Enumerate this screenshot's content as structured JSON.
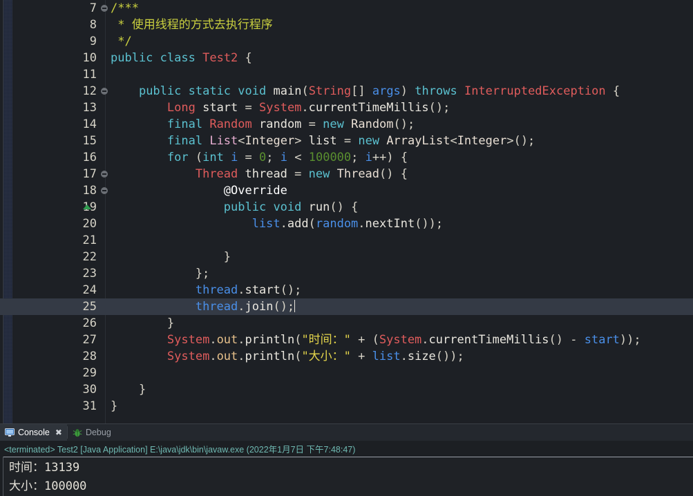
{
  "editor": {
    "first_line": 7,
    "lines": [
      {
        "no": 7,
        "fold": true,
        "override": false,
        "current": false,
        "tokens": [
          {
            "t": "/***",
            "c": "cmt"
          }
        ]
      },
      {
        "no": 8,
        "fold": false,
        "override": false,
        "current": false,
        "tokens": [
          {
            "t": " * 使用线程的方式去执行程序",
            "c": "cmt"
          }
        ]
      },
      {
        "no": 9,
        "fold": false,
        "override": false,
        "current": false,
        "tokens": [
          {
            "t": " */",
            "c": "cmt"
          }
        ]
      },
      {
        "no": 10,
        "fold": false,
        "override": false,
        "current": false,
        "tokens": [
          {
            "t": "public",
            "c": "kw"
          },
          {
            "t": " ",
            "c": "pln"
          },
          {
            "t": "class",
            "c": "kw"
          },
          {
            "t": " ",
            "c": "pln"
          },
          {
            "t": "Test2",
            "c": "typ"
          },
          {
            "t": " {",
            "c": "pct"
          }
        ]
      },
      {
        "no": 11,
        "fold": false,
        "override": false,
        "current": false,
        "tokens": []
      },
      {
        "no": 12,
        "fold": true,
        "override": false,
        "current": false,
        "tokens": [
          {
            "t": "    ",
            "c": "pln"
          },
          {
            "t": "public",
            "c": "kw"
          },
          {
            "t": " ",
            "c": "pln"
          },
          {
            "t": "static",
            "c": "kw"
          },
          {
            "t": " ",
            "c": "pln"
          },
          {
            "t": "void",
            "c": "kw"
          },
          {
            "t": " ",
            "c": "pln"
          },
          {
            "t": "main",
            "c": "pln"
          },
          {
            "t": "(",
            "c": "pct"
          },
          {
            "t": "String",
            "c": "typ"
          },
          {
            "t": "[] ",
            "c": "pct"
          },
          {
            "t": "args",
            "c": "var"
          },
          {
            "t": ") ",
            "c": "pct"
          },
          {
            "t": "throws",
            "c": "kw"
          },
          {
            "t": " ",
            "c": "pln"
          },
          {
            "t": "InterruptedException",
            "c": "typ"
          },
          {
            "t": " {",
            "c": "pct"
          }
        ]
      },
      {
        "no": 13,
        "fold": false,
        "override": false,
        "current": false,
        "tokens": [
          {
            "t": "        ",
            "c": "pln"
          },
          {
            "t": "Long",
            "c": "typ"
          },
          {
            "t": " ",
            "c": "pln"
          },
          {
            "t": "start",
            "c": "pln"
          },
          {
            "t": " = ",
            "c": "pct"
          },
          {
            "t": "System",
            "c": "typ"
          },
          {
            "t": ".",
            "c": "pct"
          },
          {
            "t": "currentTimeMillis",
            "c": "pln"
          },
          {
            "t": "();",
            "c": "pct"
          }
        ]
      },
      {
        "no": 14,
        "fold": false,
        "override": false,
        "current": false,
        "tokens": [
          {
            "t": "        ",
            "c": "pln"
          },
          {
            "t": "final",
            "c": "kw"
          },
          {
            "t": " ",
            "c": "pln"
          },
          {
            "t": "Random",
            "c": "typ"
          },
          {
            "t": " ",
            "c": "pln"
          },
          {
            "t": "random",
            "c": "pln"
          },
          {
            "t": " = ",
            "c": "pct"
          },
          {
            "t": "new",
            "c": "kw"
          },
          {
            "t": " ",
            "c": "pln"
          },
          {
            "t": "Random",
            "c": "cls"
          },
          {
            "t": "();",
            "c": "pct"
          }
        ]
      },
      {
        "no": 15,
        "fold": false,
        "override": false,
        "current": false,
        "tokens": [
          {
            "t": "        ",
            "c": "pln"
          },
          {
            "t": "final",
            "c": "kw"
          },
          {
            "t": " ",
            "c": "pln"
          },
          {
            "t": "List",
            "c": "gen"
          },
          {
            "t": "<",
            "c": "pct"
          },
          {
            "t": "Integer",
            "c": "cls"
          },
          {
            "t": "> ",
            "c": "pct"
          },
          {
            "t": "list",
            "c": "pln"
          },
          {
            "t": " = ",
            "c": "pct"
          },
          {
            "t": "new",
            "c": "kw"
          },
          {
            "t": " ",
            "c": "pln"
          },
          {
            "t": "ArrayList",
            "c": "cls"
          },
          {
            "t": "<",
            "c": "pct"
          },
          {
            "t": "Integer",
            "c": "cls"
          },
          {
            "t": ">();",
            "c": "pct"
          }
        ]
      },
      {
        "no": 16,
        "fold": false,
        "override": false,
        "current": false,
        "tokens": [
          {
            "t": "        ",
            "c": "pln"
          },
          {
            "t": "for",
            "c": "kw"
          },
          {
            "t": " (",
            "c": "pct"
          },
          {
            "t": "int",
            "c": "kw"
          },
          {
            "t": " ",
            "c": "pln"
          },
          {
            "t": "i",
            "c": "var"
          },
          {
            "t": " = ",
            "c": "pct"
          },
          {
            "t": "0",
            "c": "num"
          },
          {
            "t": "; ",
            "c": "pct"
          },
          {
            "t": "i",
            "c": "var"
          },
          {
            "t": " < ",
            "c": "pct"
          },
          {
            "t": "100000",
            "c": "num"
          },
          {
            "t": "; ",
            "c": "pct"
          },
          {
            "t": "i",
            "c": "var"
          },
          {
            "t": "++) {",
            "c": "pct"
          }
        ]
      },
      {
        "no": 17,
        "fold": true,
        "override": false,
        "current": false,
        "tokens": [
          {
            "t": "            ",
            "c": "pln"
          },
          {
            "t": "Thread",
            "c": "typ"
          },
          {
            "t": " ",
            "c": "pln"
          },
          {
            "t": "thread",
            "c": "pln"
          },
          {
            "t": " = ",
            "c": "pct"
          },
          {
            "t": "new",
            "c": "kw"
          },
          {
            "t": " ",
            "c": "pln"
          },
          {
            "t": "Thread",
            "c": "cls"
          },
          {
            "t": "() {",
            "c": "pct"
          }
        ]
      },
      {
        "no": 18,
        "fold": true,
        "override": false,
        "current": false,
        "tokens": [
          {
            "t": "                ",
            "c": "pln"
          },
          {
            "t": "@Override",
            "c": "ann"
          }
        ]
      },
      {
        "no": 19,
        "fold": false,
        "override": true,
        "current": false,
        "tokens": [
          {
            "t": "                ",
            "c": "pln"
          },
          {
            "t": "public",
            "c": "kw"
          },
          {
            "t": " ",
            "c": "pln"
          },
          {
            "t": "void",
            "c": "kw"
          },
          {
            "t": " ",
            "c": "pln"
          },
          {
            "t": "run",
            "c": "pln"
          },
          {
            "t": "() {",
            "c": "pct"
          }
        ]
      },
      {
        "no": 20,
        "fold": false,
        "override": false,
        "current": false,
        "tokens": [
          {
            "t": "                    ",
            "c": "pln"
          },
          {
            "t": "list",
            "c": "var"
          },
          {
            "t": ".",
            "c": "pct"
          },
          {
            "t": "add",
            "c": "pln"
          },
          {
            "t": "(",
            "c": "pct"
          },
          {
            "t": "random",
            "c": "var"
          },
          {
            "t": ".",
            "c": "pct"
          },
          {
            "t": "nextInt",
            "c": "pln"
          },
          {
            "t": "());",
            "c": "pct"
          }
        ]
      },
      {
        "no": 21,
        "fold": false,
        "override": false,
        "current": false,
        "tokens": []
      },
      {
        "no": 22,
        "fold": false,
        "override": false,
        "current": false,
        "tokens": [
          {
            "t": "                }",
            "c": "pct"
          }
        ]
      },
      {
        "no": 23,
        "fold": false,
        "override": false,
        "current": false,
        "tokens": [
          {
            "t": "            };",
            "c": "pct"
          }
        ]
      },
      {
        "no": 24,
        "fold": false,
        "override": false,
        "current": false,
        "tokens": [
          {
            "t": "            ",
            "c": "pln"
          },
          {
            "t": "thread",
            "c": "var"
          },
          {
            "t": ".",
            "c": "pct"
          },
          {
            "t": "start",
            "c": "pln"
          },
          {
            "t": "();",
            "c": "pct"
          }
        ]
      },
      {
        "no": 25,
        "fold": false,
        "override": false,
        "current": true,
        "tokens": [
          {
            "t": "            ",
            "c": "pln"
          },
          {
            "t": "thread",
            "c": "var"
          },
          {
            "t": ".",
            "c": "pct"
          },
          {
            "t": "join",
            "c": "pln"
          },
          {
            "t": "();",
            "c": "pct"
          }
        ],
        "caret": true
      },
      {
        "no": 26,
        "fold": false,
        "override": false,
        "current": false,
        "tokens": [
          {
            "t": "        }",
            "c": "pct"
          }
        ]
      },
      {
        "no": 27,
        "fold": false,
        "override": false,
        "current": false,
        "tokens": [
          {
            "t": "        ",
            "c": "pln"
          },
          {
            "t": "System",
            "c": "typ"
          },
          {
            "t": ".",
            "c": "pct"
          },
          {
            "t": "out",
            "c": "fld"
          },
          {
            "t": ".",
            "c": "pct"
          },
          {
            "t": "println",
            "c": "pln"
          },
          {
            "t": "(",
            "c": "pct"
          },
          {
            "t": "\"时间：\"",
            "c": "str"
          },
          {
            "t": " + (",
            "c": "pct"
          },
          {
            "t": "System",
            "c": "typ"
          },
          {
            "t": ".",
            "c": "pct"
          },
          {
            "t": "currentTimeMillis",
            "c": "pln"
          },
          {
            "t": "() - ",
            "c": "pct"
          },
          {
            "t": "start",
            "c": "var"
          },
          {
            "t": "));",
            "c": "pct"
          }
        ]
      },
      {
        "no": 28,
        "fold": false,
        "override": false,
        "current": false,
        "tokens": [
          {
            "t": "        ",
            "c": "pln"
          },
          {
            "t": "System",
            "c": "typ"
          },
          {
            "t": ".",
            "c": "pct"
          },
          {
            "t": "out",
            "c": "fld"
          },
          {
            "t": ".",
            "c": "pct"
          },
          {
            "t": "println",
            "c": "pln"
          },
          {
            "t": "(",
            "c": "pct"
          },
          {
            "t": "\"大小：\"",
            "c": "str"
          },
          {
            "t": " + ",
            "c": "pct"
          },
          {
            "t": "list",
            "c": "var"
          },
          {
            "t": ".",
            "c": "pct"
          },
          {
            "t": "size",
            "c": "pln"
          },
          {
            "t": "());",
            "c": "pct"
          }
        ]
      },
      {
        "no": 29,
        "fold": false,
        "override": false,
        "current": false,
        "tokens": []
      },
      {
        "no": 30,
        "fold": false,
        "override": false,
        "current": false,
        "tokens": [
          {
            "t": "    }",
            "c": "pct"
          }
        ]
      },
      {
        "no": 31,
        "fold": false,
        "override": false,
        "current": false,
        "tokens": [
          {
            "t": "}",
            "c": "pct"
          }
        ]
      }
    ]
  },
  "panel": {
    "tabs": [
      {
        "label": "Console",
        "icon": "console-monitor-icon",
        "active": true,
        "closable": true
      },
      {
        "label": "Debug",
        "icon": "debug-bug-icon",
        "active": false,
        "closable": false
      }
    ],
    "terminated_line": "<terminated> Test2 [Java Application] E:\\java\\jdk\\bin\\javaw.exe (2022年1月7日 下午7:48:47)",
    "output": [
      "时间：13139",
      "大小：100000"
    ]
  },
  "colors": {
    "editor_bg": "#1d2025",
    "panel_bg": "#1c1f23",
    "current_line_bg": "#343a45",
    "line_number": "#d6d3c7",
    "keyword": "#5bc1d0",
    "type": "#e05c5c",
    "string": "#e3d44b",
    "comment": "#c9cf3f",
    "number": "#5a8f2f",
    "variable": "#4a8fe8",
    "field": "#e6c08a",
    "terminated_text": "#6fb9b2",
    "override_marker": "#2e9b4e"
  }
}
